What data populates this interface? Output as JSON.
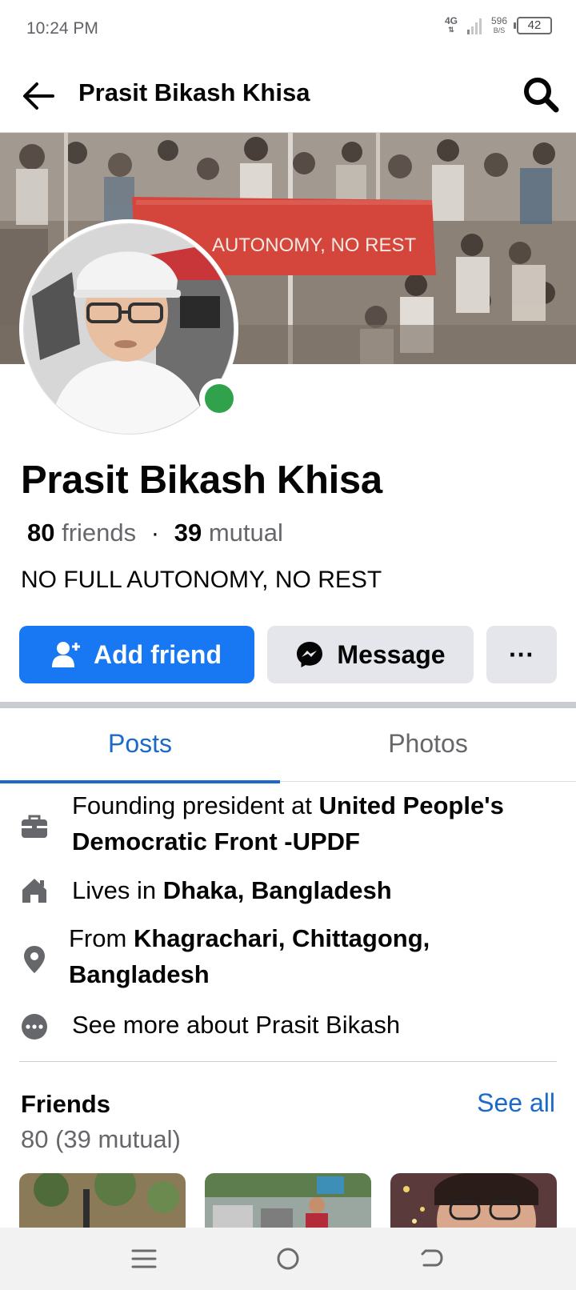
{
  "status": {
    "time": "10:24 PM",
    "network": "4G",
    "speed_value": "596",
    "speed_unit": "B/S",
    "battery": "42"
  },
  "header": {
    "title": "Prasit Bikash Khisa",
    "back_icon": "arrow-left-icon",
    "search_icon": "search-icon"
  },
  "profile": {
    "name": "Prasit Bikash Khisa",
    "friends_count": "80",
    "friends_label": "friends",
    "mutual_count": "39",
    "mutual_label": "mutual",
    "bio": "NO FULL AUTONOMY, NO REST",
    "online_color": "#31a24c"
  },
  "cover": {
    "banner_text": "AUTONOMY, NO REST"
  },
  "actions": {
    "add_friend": "Add friend",
    "message": "Message",
    "more": "···"
  },
  "tabs": [
    {
      "label": "Posts",
      "active": true
    },
    {
      "label": "Photos",
      "active": false
    }
  ],
  "intro": {
    "work_prefix": "Founding president at ",
    "work_place": "United People's Democratic Front -UPDF",
    "lives_prefix": "Lives in ",
    "lives_place": "Dhaka, Bangladesh",
    "from_prefix": "From ",
    "from_place": "Khagrachari, Chittagong, Bangladesh",
    "see_more": "See more about Prasit Bikash"
  },
  "friends": {
    "title": "Friends",
    "see_all": "See all",
    "count_text": "80 (39 mutual)"
  },
  "colors": {
    "accent": "#1877f2",
    "link": "#1b6ac9",
    "secondary_button": "#e4e6eb"
  }
}
